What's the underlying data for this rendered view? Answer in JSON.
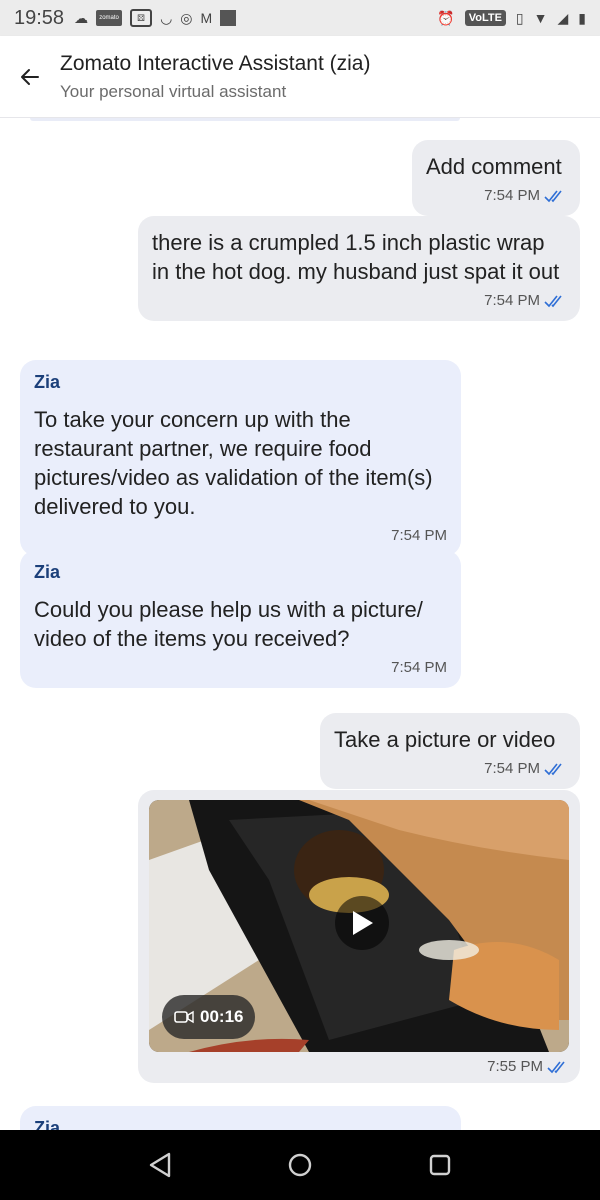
{
  "status_bar": {
    "time": "19:58",
    "volte": "VoLTE"
  },
  "header": {
    "title": "Zomato Interactive Assistant (zia)",
    "subtitle": "Your personal virtual assistant"
  },
  "messages": [
    {
      "direction": "out",
      "text": "Add comment",
      "time": "7:54 PM",
      "read": true
    },
    {
      "direction": "out",
      "text": "there is a crumpled 1.5 inch plastic wrap in the hot dog. my husband just spat it out",
      "time": "7:54 PM",
      "read": true
    },
    {
      "direction": "in",
      "sender": "Zia",
      "text": "To take your concern up with the restaurant partner, we require food pictures/video as validation of the item(s) delivered to you.",
      "time": "7:54 PM"
    },
    {
      "direction": "in",
      "sender": "Zia",
      "text": "Could you please help us with a picture/ video of the items you received?",
      "time": "7:54 PM"
    },
    {
      "direction": "out",
      "text": "Take a picture or video",
      "time": "7:54 PM",
      "read": true
    },
    {
      "direction": "out",
      "type": "video",
      "duration": "00:16",
      "time": "7:55 PM",
      "read": true
    },
    {
      "direction": "in",
      "sender": "Zia"
    }
  ],
  "colors": {
    "out_bubble": "#ebecf0",
    "in_bubble": "#eaeefb",
    "sender_name": "#1b3f7a",
    "read_ticks": "#2f6fd6"
  },
  "icons": {
    "back": "arrow-left-icon",
    "play": "play-icon",
    "video_camera": "video-camera-icon",
    "nav_back": "triangle-back-icon",
    "nav_home": "circle-home-icon",
    "nav_recents": "square-recents-icon"
  }
}
